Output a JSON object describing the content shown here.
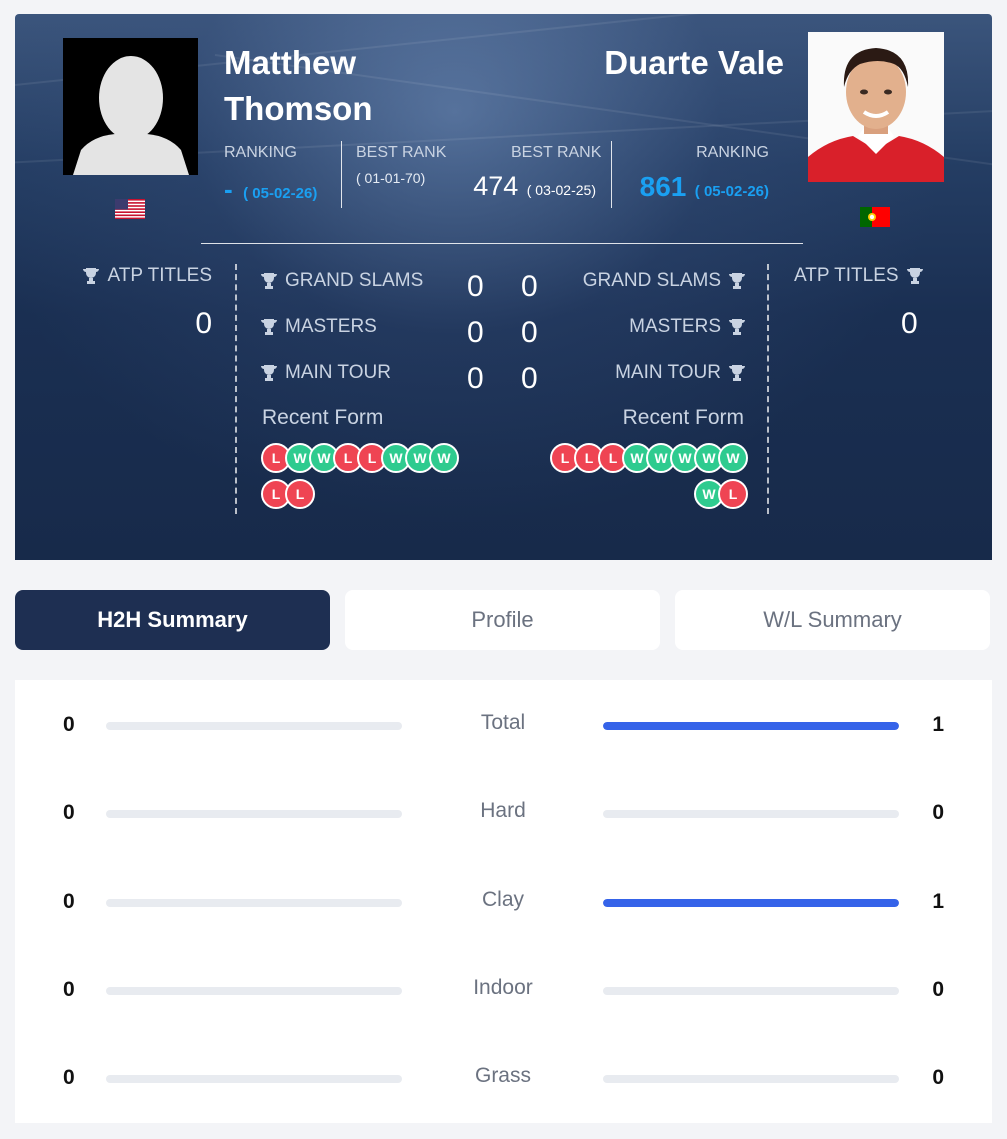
{
  "player_left": {
    "name": "Matthew Thomson",
    "name_line1": "Matthew",
    "name_line2": "Thomson",
    "ranking_label": "RANKING",
    "ranking_value": "-",
    "ranking_date": "( 05-02-26)",
    "best_rank_label": "BEST RANK",
    "best_rank_date": "( 01-01-70)",
    "flag": "usa-flag",
    "atp_titles_label": "ATP TITLES",
    "atp_titles": "0",
    "grand_slams": "0",
    "masters": "0",
    "main_tour": "0",
    "recent_form": [
      "L",
      "W",
      "W",
      "L",
      "L",
      "W",
      "W",
      "W",
      "L",
      "L"
    ]
  },
  "player_right": {
    "name": "Duarte Vale",
    "ranking_label": "RANKING",
    "ranking_value": "861",
    "ranking_date": "( 05-02-26)",
    "best_rank_label": "BEST RANK",
    "best_rank_value": "474",
    "best_rank_date": "( 03-02-25)",
    "flag": "portugal-flag",
    "atp_titles_label": "ATP TITLES",
    "atp_titles": "0",
    "grand_slams": "0",
    "masters": "0",
    "main_tour": "0",
    "recent_form": [
      "L",
      "L",
      "L",
      "W",
      "W",
      "W",
      "W",
      "W",
      "W",
      "L"
    ]
  },
  "labels": {
    "grand_slams": "GRAND SLAMS",
    "masters": "MASTERS",
    "main_tour": "MAIN TOUR",
    "recent_form": "Recent Form"
  },
  "tabs": [
    {
      "label": "H2H Summary",
      "active": true
    },
    {
      "label": "Profile",
      "active": false
    },
    {
      "label": "W/L Summary",
      "active": false
    }
  ],
  "h2h": [
    {
      "label": "Total",
      "left": "0",
      "right": "1"
    },
    {
      "label": "Hard",
      "left": "0",
      "right": "0"
    },
    {
      "label": "Clay",
      "left": "0",
      "right": "1"
    },
    {
      "label": "Indoor",
      "left": "0",
      "right": "0"
    },
    {
      "label": "Grass",
      "left": "0",
      "right": "0"
    }
  ],
  "colors": {
    "hero_bg": "#1a2f52",
    "accent_blue": "#1aa0f2",
    "bar_blue": "#3563e9",
    "win_green": "#2ecb8f",
    "loss_red": "#ef4453",
    "active_tab": "#1e2f52"
  }
}
